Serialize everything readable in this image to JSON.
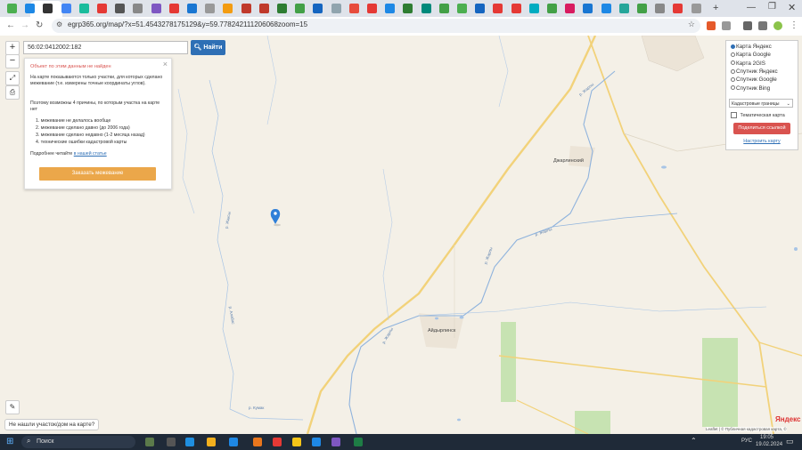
{
  "browser": {
    "url": "egrp365.org/map/?x=51.4543278175129&y=59.778242111206068zoom=15",
    "new_tab": "+"
  },
  "map": {
    "zoom_in": "+",
    "zoom_out": "−",
    "search_value": "56:02:0412002:182",
    "find_label": "Найти",
    "popup": {
      "title": "Объект по этим данным не найден",
      "intro": "На карте показываются только участки, для которых сделано межевание (т.е. измерены точные координаты углов).",
      "reasons_intro": "Поэтому возможны 4 причины, по которым участка на карте нет",
      "reasons": [
        "1. межевание не делалось вообще",
        "2. межевание сделано давно (до 2006 года)",
        "3. межевание сделано недавно (1-2 месяца назад)",
        "4. технические ошибки кадастровой карты"
      ],
      "more_prefix": "Подробнее читайте",
      "more_link": "в нашей статье",
      "order_button": "Заказать межевание",
      "close": "×"
    },
    "layers": {
      "options": [
        "Карта Яндекс",
        "Карта Google",
        "Карта 2GIS",
        "Спутник Яндекс",
        "Спутник Google",
        "Спутник Bing"
      ],
      "selected": 0,
      "select_value": "Кадастровые границы",
      "thematic_label": "Тематическая карта",
      "share_button": "Поделиться ссылкой",
      "customize_link": "Настроить карту"
    },
    "places": {
      "dzharlinsky": "Джарлинский",
      "aidyrlinsk": "Айдырлинск"
    },
    "rivers": {
      "r1": "р. Жарлы",
      "r2": "р. Жарлы",
      "r3": "р. Жарлы",
      "r4": "р. Жарлы",
      "r5": "р. Жаксы",
      "r6": "р. Алабас",
      "r7": "р. Кумак"
    },
    "not_found_link": "Не нашли участок/дом на карте?",
    "attribution": "Leaflet | © Публичная кадастровая карта, ©",
    "brand": "Яндекс"
  },
  "taskbar": {
    "search_label": "Поиск",
    "lang": "РУС",
    "time": "19:05",
    "date": "19.02.2024"
  },
  "colors": {
    "accent": "#2e6fb5",
    "order": "#eba74a",
    "share": "#d9534f"
  }
}
